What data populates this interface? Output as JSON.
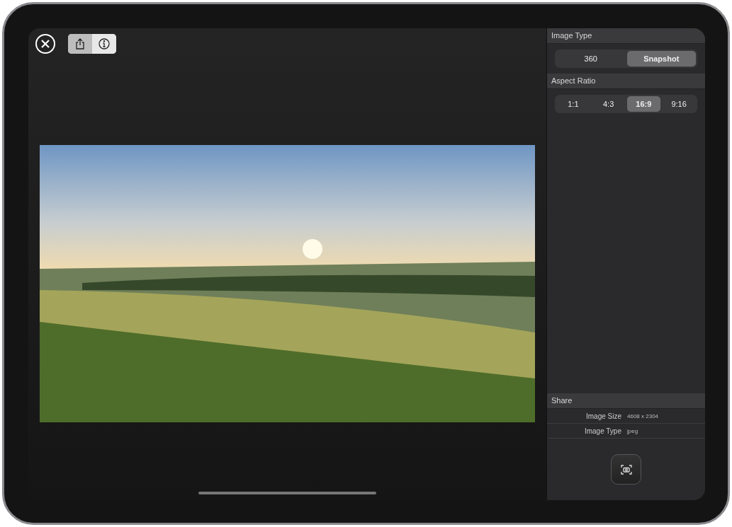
{
  "toolbar": {
    "segments": [
      {
        "kind": "share",
        "selected": true
      },
      {
        "kind": "info",
        "selected": false
      }
    ]
  },
  "sidebar": {
    "sections": [
      {
        "title": "Image Type",
        "options": [
          {
            "label": "360",
            "selected": false
          },
          {
            "label": "Snapshot",
            "selected": true
          }
        ]
      },
      {
        "title": "Aspect Ratio",
        "options": [
          {
            "label": "1:1",
            "selected": false
          },
          {
            "label": "4:3",
            "selected": false
          },
          {
            "label": "16:9",
            "selected": true
          },
          {
            "label": "9:16",
            "selected": false
          }
        ]
      }
    ],
    "share": {
      "title": "Share",
      "rows": [
        {
          "label": "Image Size",
          "value": "4608 x 2304"
        },
        {
          "label": "Image Type",
          "value": "jpeg"
        }
      ]
    }
  }
}
